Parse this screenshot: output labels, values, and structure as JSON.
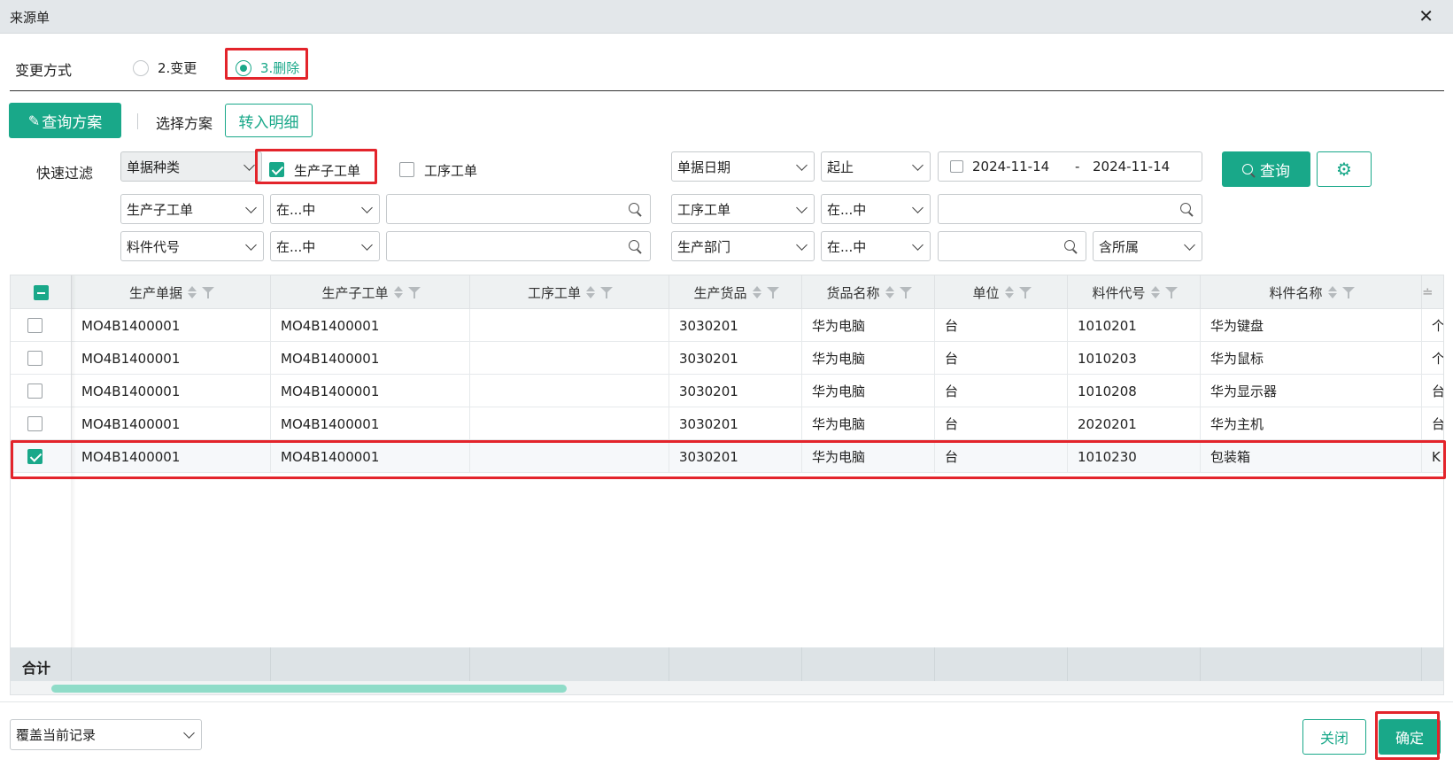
{
  "window": {
    "title": "来源单",
    "close_symbol": "✕"
  },
  "change_mode": {
    "label": "变更方式",
    "options": [
      {
        "label": "2.变更",
        "selected": false
      },
      {
        "label": "3.删除",
        "selected": true
      }
    ]
  },
  "toolbar": {
    "query_scheme_label": "查询方案",
    "select_scheme_label": "选择方案",
    "transfer_detail_label": "转入明细"
  },
  "quick_filter": {
    "label": "快速过滤",
    "doc_type_select": "单据种类",
    "checkbox_production_sub": {
      "label": "生产子工单",
      "checked": true
    },
    "checkbox_process_order": {
      "label": "工序工单",
      "checked": false
    },
    "doc_date_select": "单据日期",
    "range_select": "起止",
    "date_start": "2024-11-14",
    "date_sep": "-",
    "date_end": "2024-11-14",
    "query_button": "查询",
    "row2": {
      "field1": "生产子工单",
      "op1": "在...中",
      "field2": "工序工单",
      "op2": "在...中"
    },
    "row3": {
      "field1": "料件代号",
      "op1": "在...中",
      "field2": "生产部门",
      "op2": "在...中",
      "scope": "含所属"
    }
  },
  "table": {
    "columns": [
      "生产单据",
      "生产子工单",
      "工序工单",
      "生产货品",
      "货品名称",
      "单位",
      "料件代号",
      "料件名称"
    ],
    "partial_column_glyph": "≐",
    "rows": [
      {
        "checked": false,
        "doc": "MO4B1400001",
        "sub": "MO4B1400001",
        "proc": "",
        "goods": "3030201",
        "goods_name": "华为电脑",
        "unit": "台",
        "part_code": "1010201",
        "part_name": "华为键盘",
        "extra": "个"
      },
      {
        "checked": false,
        "doc": "MO4B1400001",
        "sub": "MO4B1400001",
        "proc": "",
        "goods": "3030201",
        "goods_name": "华为电脑",
        "unit": "台",
        "part_code": "1010203",
        "part_name": "华为鼠标",
        "extra": "个"
      },
      {
        "checked": false,
        "doc": "MO4B1400001",
        "sub": "MO4B1400001",
        "proc": "",
        "goods": "3030201",
        "goods_name": "华为电脑",
        "unit": "台",
        "part_code": "1010208",
        "part_name": "华为显示器",
        "extra": "台"
      },
      {
        "checked": false,
        "doc": "MO4B1400001",
        "sub": "MO4B1400001",
        "proc": "",
        "goods": "3030201",
        "goods_name": "华为电脑",
        "unit": "台",
        "part_code": "2020201",
        "part_name": "华为主机",
        "extra": "台"
      },
      {
        "checked": true,
        "doc": "MO4B1400001",
        "sub": "MO4B1400001",
        "proc": "",
        "goods": "3030201",
        "goods_name": "华为电脑",
        "unit": "台",
        "part_code": "1010230",
        "part_name": "包装箱",
        "extra": "K"
      }
    ],
    "footer_label": "合计"
  },
  "footer": {
    "mode_select": "覆盖当前记录",
    "close_button": "关闭",
    "confirm_button": "确定"
  },
  "colors": {
    "accent": "#19a889",
    "highlight": "#e3242b"
  }
}
